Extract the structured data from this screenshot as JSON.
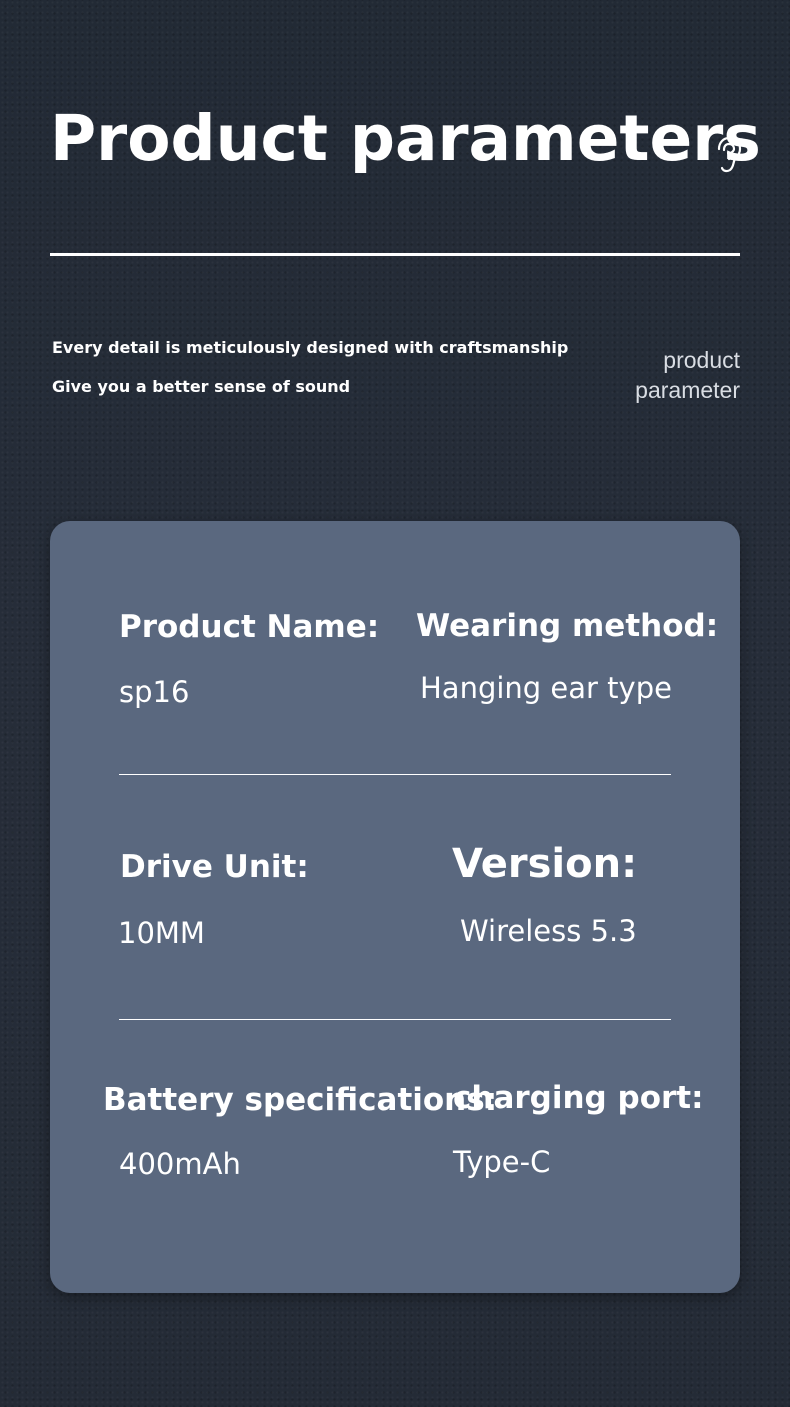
{
  "header": {
    "title": "Product parameters",
    "icon": "ear-icon",
    "tagline_1": "Every detail is meticulously designed with craftsmanship",
    "tagline_2": "Give you a better sense of sound",
    "side_label_1": "product",
    "side_label_2": "parameter"
  },
  "params": {
    "product_name_label": "Product Name:",
    "product_name_value": "sp16",
    "wearing_label": "Wearing method:",
    "wearing_value": "Hanging ear type",
    "drive_label": "Drive Unit:",
    "drive_value": "10MM",
    "version_label": "Version:",
    "version_value": "Wireless 5.3",
    "battery_label": "Battery specifications:",
    "battery_value": "400mAh",
    "charging_label": "charging port:",
    "charging_value": "Type-C"
  },
  "colors": {
    "background": "#232a36",
    "card": "#5a687f",
    "text": "#ffffff",
    "side_label": "#d9dde3"
  }
}
